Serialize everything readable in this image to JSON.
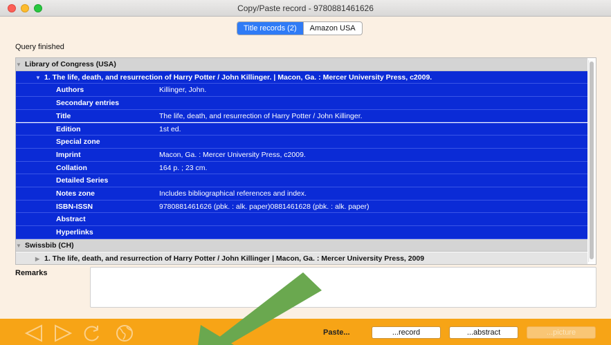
{
  "window": {
    "title": "Copy/Paste record - 9780881461626"
  },
  "tabs": [
    {
      "label": "Title records (2)",
      "active": true
    },
    {
      "label": "Amazon USA",
      "active": false
    }
  ],
  "status": "Query finished",
  "results": {
    "groups": [
      {
        "source": "Library of Congress (USA)",
        "expanded": true,
        "record": {
          "heading": "1. The life, death, and resurrection of Harry Potter / John Killinger. | Macon, Ga. : Mercer University Press, c2009.",
          "expanded": true,
          "fields": [
            {
              "label": "Authors",
              "value": "Killinger, John."
            },
            {
              "label": "Secondary entries",
              "value": ""
            },
            {
              "label": "Title",
              "value": "The life, death, and resurrection of Harry Potter / John Killinger."
            },
            {
              "label": "Edition",
              "value": "1st ed."
            },
            {
              "label": "Special zone",
              "value": ""
            },
            {
              "label": "Imprint",
              "value": "Macon, Ga. : Mercer University Press, c2009."
            },
            {
              "label": "Collation",
              "value": "164 p. ; 23 cm."
            },
            {
              "label": "Detailed Series",
              "value": ""
            },
            {
              "label": "Notes zone",
              "value": "Includes bibliographical references and index."
            },
            {
              "label": "ISBN-ISSN",
              "value": "9780881461626 (pbk. : alk. paper)0881461628 (pbk. : alk. paper)"
            },
            {
              "label": "Abstract",
              "value": ""
            },
            {
              "label": "Hyperlinks",
              "value": ""
            }
          ]
        }
      },
      {
        "source": "Swissbib (CH)",
        "expanded": true,
        "record": {
          "heading": "1. The life, death, and resurrection of Harry Potter / John Killinger | Macon, Ga. : Mercer University Press, 2009",
          "expanded": false
        }
      }
    ]
  },
  "remarks": {
    "label": "Remarks",
    "value": ""
  },
  "bottombar": {
    "nav_icons": [
      "back-triangle-icon",
      "forward-triangle-icon",
      "reload-icon",
      "globe-icon"
    ],
    "paste_label": "Paste...",
    "record_button": "...record",
    "abstract_button": "...abstract",
    "picture_button": "...picture"
  },
  "colors": {
    "selection": "#0b2bd6",
    "bottombar": "#f7a416",
    "tab_active": "#2f7bf6",
    "overlay_arrow": "#6aa84f"
  }
}
